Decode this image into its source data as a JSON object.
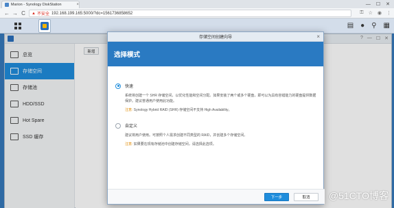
{
  "browser": {
    "tab_title": "Marion - Synology DiskStation",
    "tab_close": "×",
    "nav_back": "←",
    "nav_forward": "→",
    "nav_reload": "C",
    "insecure_label": "不安全",
    "url": "192.168.199.165:5000/?dc=1561736858652",
    "win_min": "—",
    "win_max": "☐",
    "win_close": "✕"
  },
  "dsm": {
    "right_icons": [
      "chat-icon",
      "user-icon",
      "search-icon",
      "widgets-icon"
    ]
  },
  "sidebar": {
    "items": [
      {
        "label": "总览",
        "icon": "overview-icon",
        "active": false
      },
      {
        "label": "存储空间",
        "icon": "storage-pool-icon",
        "active": true
      },
      {
        "label": "存储池",
        "icon": "volume-icon",
        "active": false
      },
      {
        "label": "HDD/SSD",
        "icon": "hdd-icon",
        "active": false
      },
      {
        "label": "Hot Spare",
        "icon": "hot-spare-icon",
        "active": false
      },
      {
        "label": "SSD 缓存",
        "icon": "ssd-cache-icon",
        "active": false
      }
    ]
  },
  "content": {
    "new_button": "新增"
  },
  "wizard": {
    "title": "存储空间创建向导",
    "close": "×",
    "header": "选择模式",
    "options": [
      {
        "label": "快速",
        "checked": true,
        "description": "系统将创建一个 SHR 存储空间，以优化性能和空间分配。如果安装了两个或多个硬盘，即可以为具有容错能力的硬盘提供数据保护。建议普通用户使用此功能。",
        "note_label": "注意:",
        "note": "Synology Hybrid RAID (SHR) 存储空间不支持 High Availability。"
      },
      {
        "label": "自定义",
        "checked": false,
        "description": "建议将用户使用。可按照个人需求创建不同类型的 RAID，并创建多个存储空间。",
        "note_label": "注意:",
        "note": "如果要在现有存储池中创建存储空间，请选择此选项。"
      }
    ],
    "next_button": "下一步",
    "cancel_button": "取消"
  },
  "watermark": {
    "text": "@51CTO博客"
  },
  "colors": {
    "accent": "#1f8ddc",
    "wizard_header": "#2a7ac2",
    "desktop": "#2f6aa4",
    "note": "#e08a00",
    "insecure": "#d93025"
  }
}
